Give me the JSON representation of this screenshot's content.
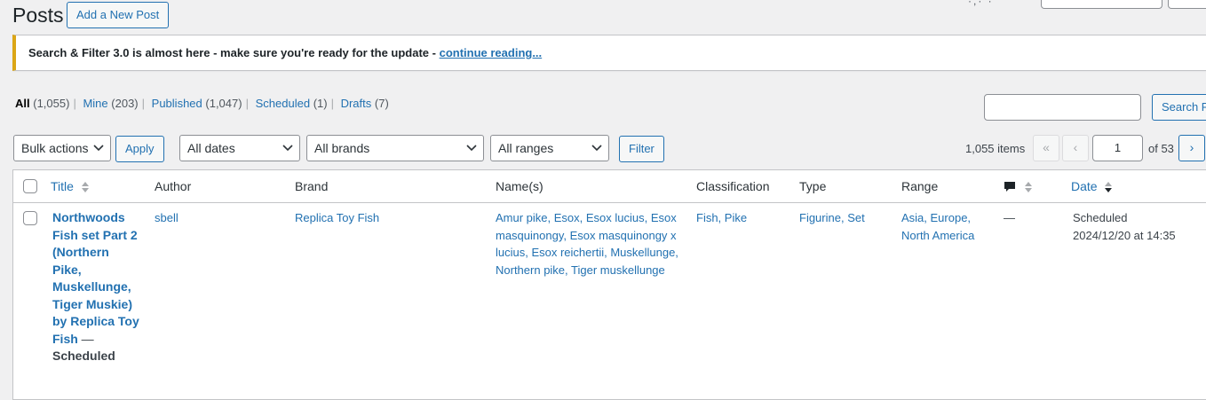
{
  "header": {
    "title": "Posts",
    "add_new_label": "Add a New Post"
  },
  "notice": {
    "text": "Search & Filter 3.0 is almost here - make sure you're ready for the update - ",
    "link": "continue reading..."
  },
  "views": [
    {
      "label": "All",
      "count": "(1,055)"
    },
    {
      "label": "Mine",
      "count": "(203)"
    },
    {
      "label": "Published",
      "count": "(1,047)"
    },
    {
      "label": "Scheduled",
      "count": "(1)"
    },
    {
      "label": "Drafts",
      "count": "(7)"
    }
  ],
  "search": {
    "button_label": "Search P"
  },
  "filters": {
    "bulk_actions": "Bulk actions",
    "apply_label": "Apply",
    "dates": "All dates",
    "brands": "All brands",
    "ranges": "All ranges",
    "filter_label": "Filter"
  },
  "pagination": {
    "items": "1,055 items",
    "first": "«",
    "prev": "‹",
    "current_page": "1",
    "of_label": "of 53",
    "next": "›"
  },
  "table": {
    "columns": {
      "title": "Title",
      "author": "Author",
      "brand": "Brand",
      "names": "Name(s)",
      "classification": "Classification",
      "type": "Type",
      "range": "Range",
      "date": "Date"
    },
    "rows": [
      {
        "title_lines": [
          "Northwoods",
          "Fish set Part 2",
          "(Northern",
          "Pike,",
          "Muskellunge,",
          "Tiger Muskie)",
          "by Replica Toy",
          "Fish"
        ],
        "title_dash": " —",
        "state": "Scheduled",
        "author": "sbell",
        "brand": "Replica Toy Fish",
        "names_lines": [
          "Amur pike, Esox, Esox lucius, Esox",
          "masquinongy, Esox masquinongy x",
          "lucius, Esox reichertii, Muskellunge,",
          "Northern pike, Tiger muskellunge"
        ],
        "classification": "Fish, Pike",
        "type": "Figurine, Set",
        "range_lines": [
          "Asia, Europe,",
          "North America"
        ],
        "comments": "—",
        "date_status": "Scheduled",
        "date_value": "2024/12/20 at 14:35"
      }
    ]
  },
  "colors": {
    "accent": "#2271b1",
    "notice_border": "#dba617",
    "background": "#f0f0f1"
  }
}
